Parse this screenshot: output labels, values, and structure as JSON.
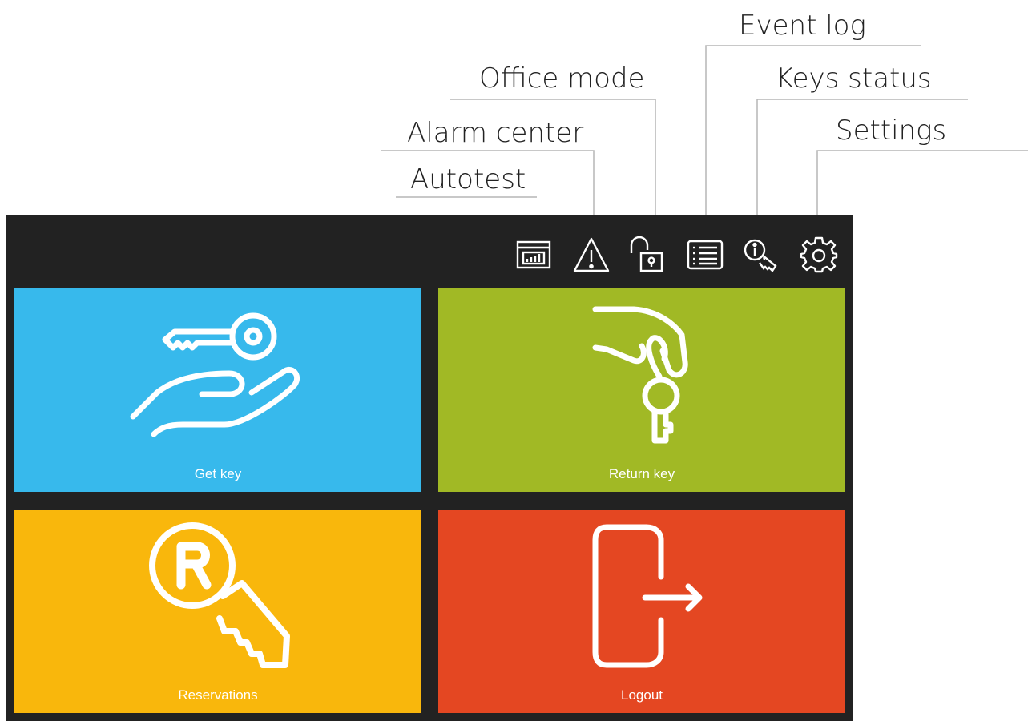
{
  "callouts": {
    "event_log": "Event log",
    "office_mode": "Office mode",
    "keys_status": "Keys status",
    "alarm_center": "Alarm center",
    "settings": "Settings",
    "autotest": "Autotest"
  },
  "toolbar_icons": [
    "autotest-icon",
    "alarm-icon",
    "office-mode-lock-icon",
    "event-log-list-icon",
    "keys-status-icon",
    "settings-gear-icon"
  ],
  "tiles": {
    "get_key": {
      "label": "Get key",
      "color": "#37b9ec"
    },
    "return_key": {
      "label": "Return key",
      "color": "#a1b925"
    },
    "reservations": {
      "label": "Reservations",
      "color": "#f9b70c"
    },
    "logout": {
      "label": "Logout",
      "color": "#e44722"
    }
  },
  "colors": {
    "panel": "#222222",
    "callout_line": "#b5b5b5"
  }
}
